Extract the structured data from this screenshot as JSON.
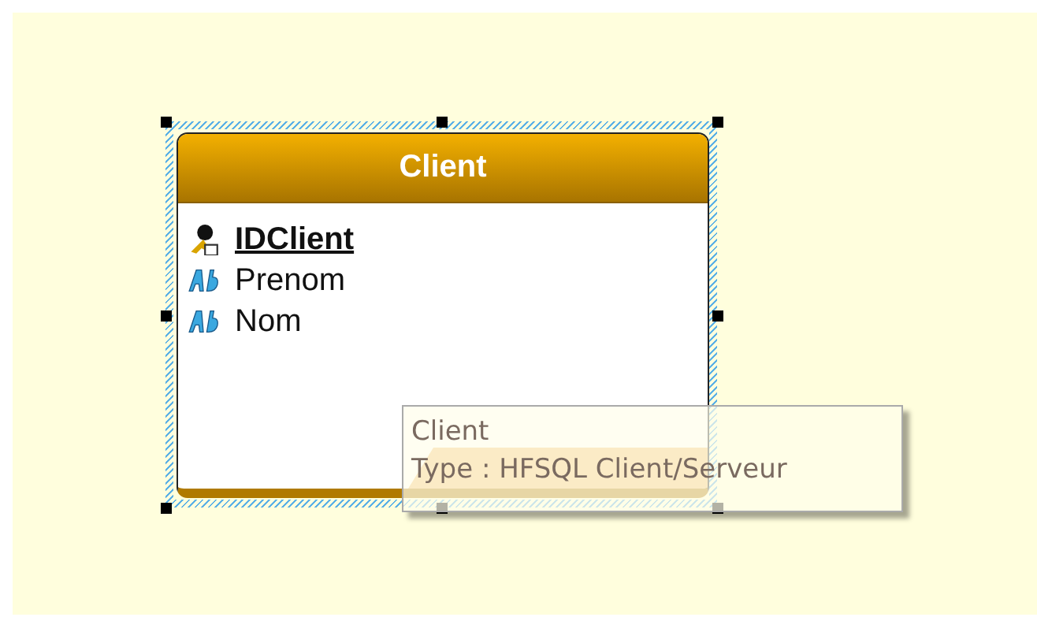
{
  "table": {
    "title": "Client",
    "selected": true,
    "fields": [
      {
        "name": "IDClient",
        "kind": "key"
      },
      {
        "name": "Prenom",
        "kind": "text"
      },
      {
        "name": "Nom",
        "kind": "text"
      }
    ]
  },
  "tooltip": {
    "title": "Client",
    "type": "Type : HFSQL Client/Serveur"
  }
}
